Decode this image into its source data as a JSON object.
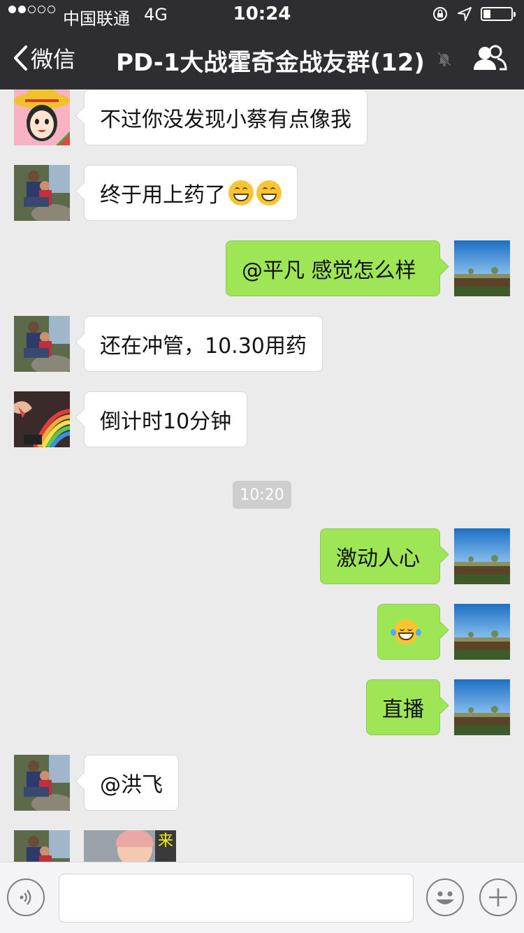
{
  "status_bar": {
    "carrier": "中国联通",
    "network": "4G",
    "time": "10:24",
    "signal_bars": 2,
    "signal_total": 5,
    "battery_level": 0.25
  },
  "nav": {
    "back_label": "微信",
    "title": "PD-1大战霍奇金战友群(12)"
  },
  "messages": [
    {
      "side": "in",
      "text": "不过你没发现小蔡有点像我",
      "avatar": "cartoon-girl-avatar"
    },
    {
      "side": "in",
      "text": "终于用上药了",
      "emoji": "grinning-face-icon ×2",
      "avatar": "family-photo-avatar"
    },
    {
      "side": "out",
      "text": "@平凡 感觉怎么样",
      "avatar": "landscape-avatar"
    },
    {
      "side": "in",
      "text": "还在冲管，10.30用药",
      "avatar": "family-photo-avatar"
    },
    {
      "side": "in",
      "text": "倒计时10分钟",
      "avatar": "rainbow-hands-avatar"
    },
    {
      "side": "out",
      "text": "激动人心",
      "avatar": "landscape-avatar"
    },
    {
      "side": "out",
      "text": "",
      "emoji": "tears-of-joy-icon",
      "avatar": "landscape-avatar"
    },
    {
      "side": "out",
      "text": "直播",
      "avatar": "landscape-avatar"
    },
    {
      "side": "in",
      "text": "@洪飞",
      "avatar": "family-photo-avatar"
    },
    {
      "side": "in",
      "image_caption": "来",
      "avatar": "family-photo-avatar"
    }
  ],
  "timestamp_divider": "10:20",
  "input": {
    "value": "",
    "placeholder": ""
  },
  "colors": {
    "nav_bg": "#2e2d32",
    "chat_bg": "#ebebeb",
    "out_bubble": "#9fe657",
    "in_bubble": "#ffffff"
  }
}
